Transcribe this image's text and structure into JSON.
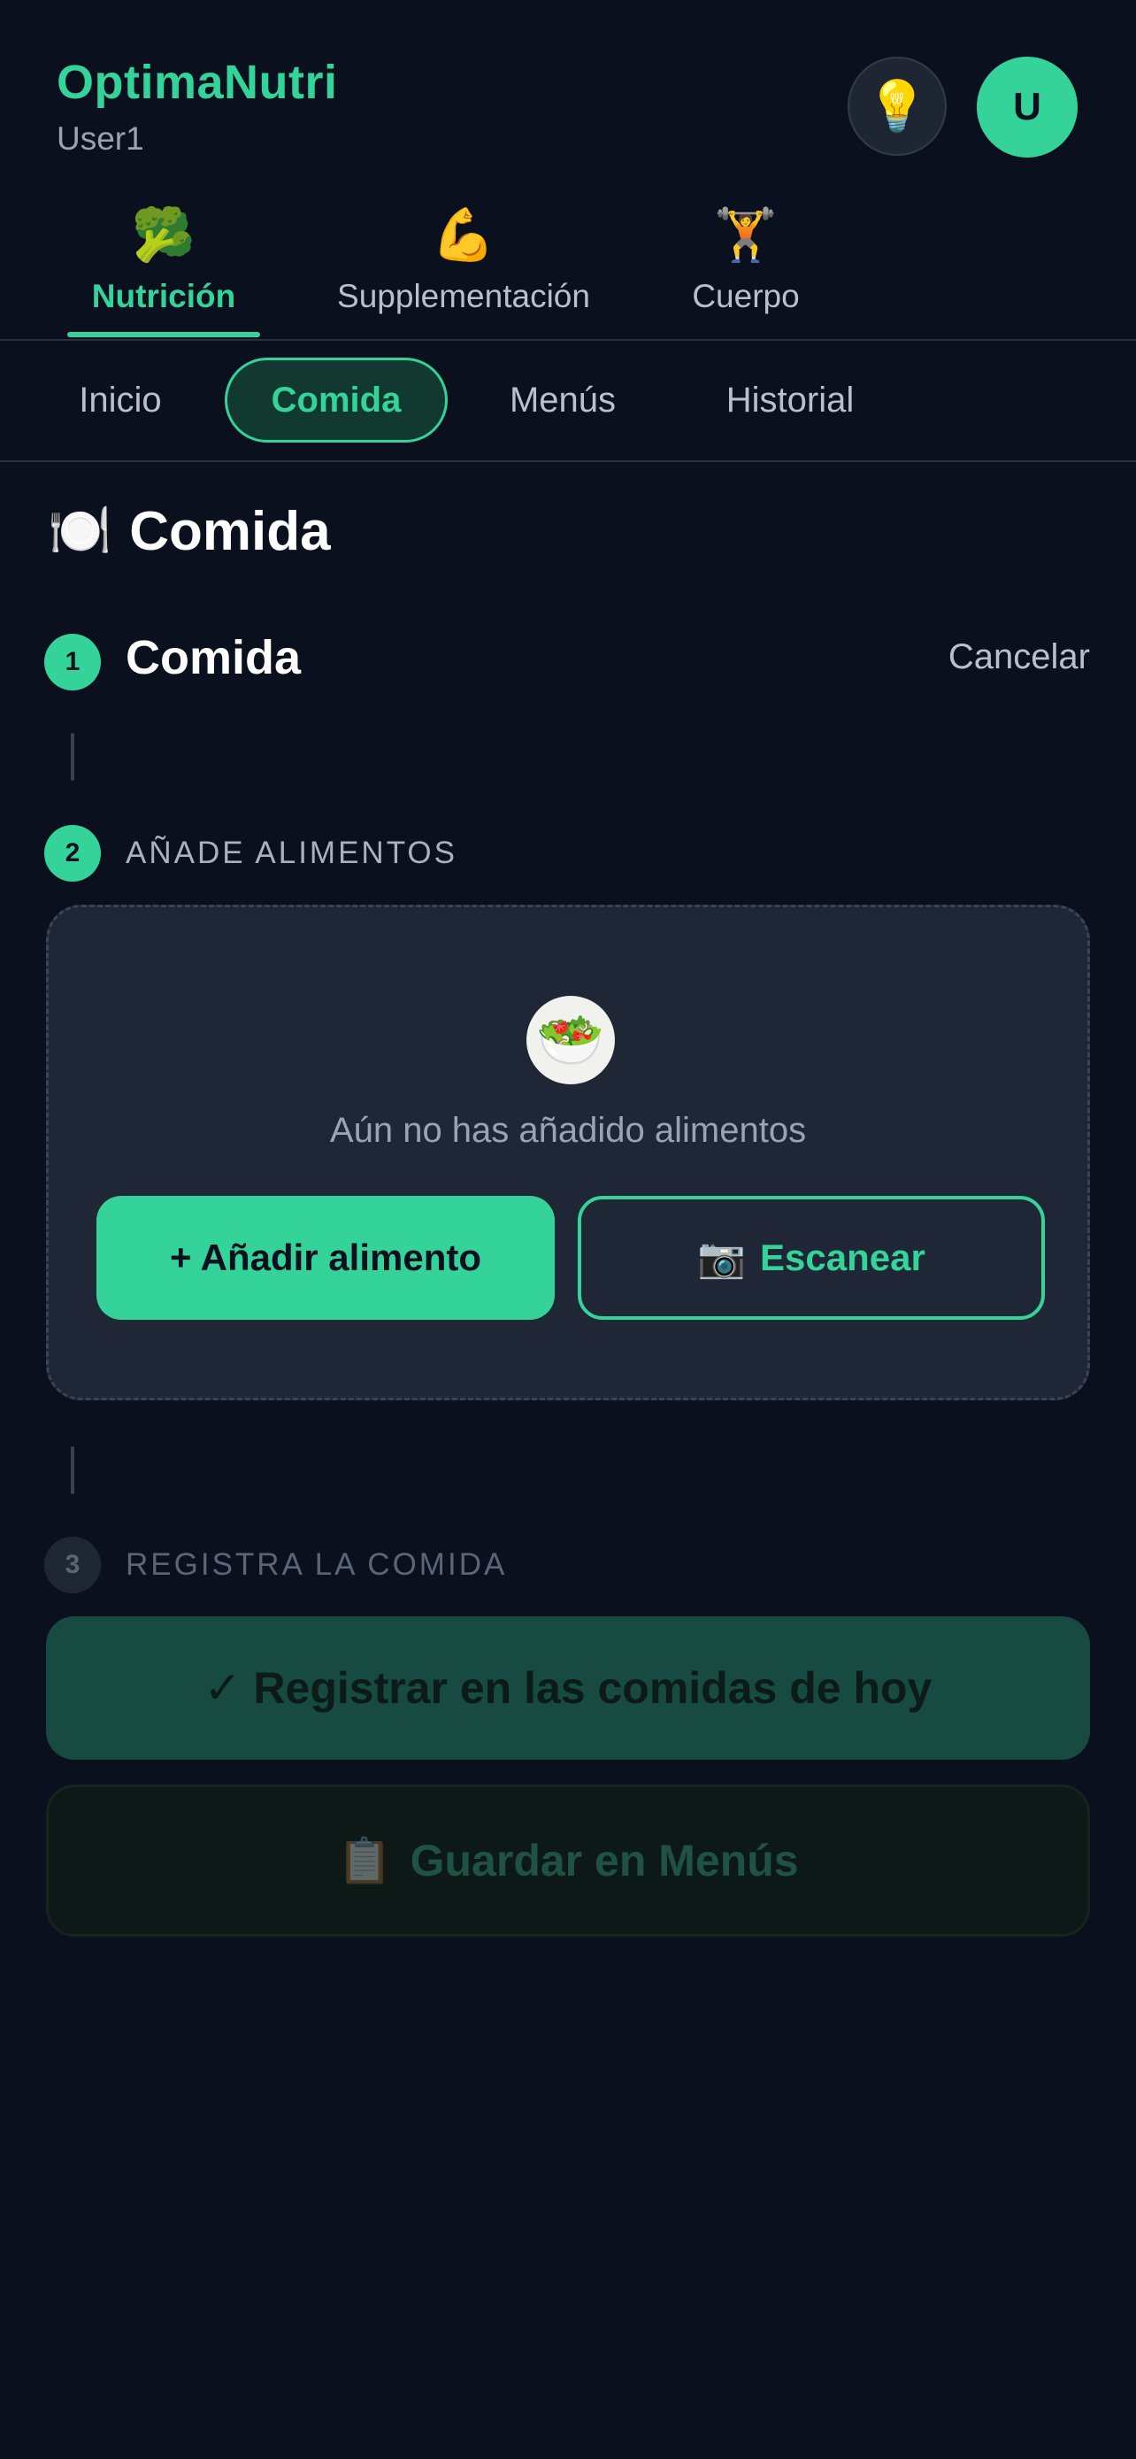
{
  "header": {
    "app_name": "OptimaNutri",
    "user_name": "User1",
    "idea_icon": "💡",
    "avatar_initial": "U"
  },
  "main_tabs": [
    {
      "icon": "🥦",
      "label": "Nutrición",
      "active": true
    },
    {
      "icon": "💪",
      "label": "Supplementación",
      "active": false
    },
    {
      "icon": "🏋️",
      "label": "Cuerpo",
      "active": false
    }
  ],
  "sub_tabs": [
    {
      "label": "Inicio",
      "active": false
    },
    {
      "label": "Comida",
      "active": true
    },
    {
      "label": "Menús",
      "active": false
    },
    {
      "label": "Historial",
      "active": false
    }
  ],
  "page": {
    "title_icon": "🍽️",
    "title": "Comida"
  },
  "steps": {
    "step1": {
      "number": "1",
      "label": "Comida",
      "cancel_label": "Cancelar"
    },
    "step2": {
      "number": "2",
      "label": "AÑADE ALIMENTOS"
    },
    "step3": {
      "number": "3",
      "label": "REGISTRA LA COMIDA"
    }
  },
  "food_box": {
    "icon": "🥗",
    "empty_text": "Aún no has añadido alimentos",
    "add_button": "+ Añadir alimento",
    "scan_icon": "📷",
    "scan_button": "Escanear"
  },
  "actions": {
    "register_button": "✓ Registrar en las comidas de hoy",
    "save_icon": "📋",
    "save_button": "Guardar en Menús"
  },
  "colors": {
    "background": "#0a101d",
    "accent": "#34d399",
    "card": "#1f2736"
  }
}
